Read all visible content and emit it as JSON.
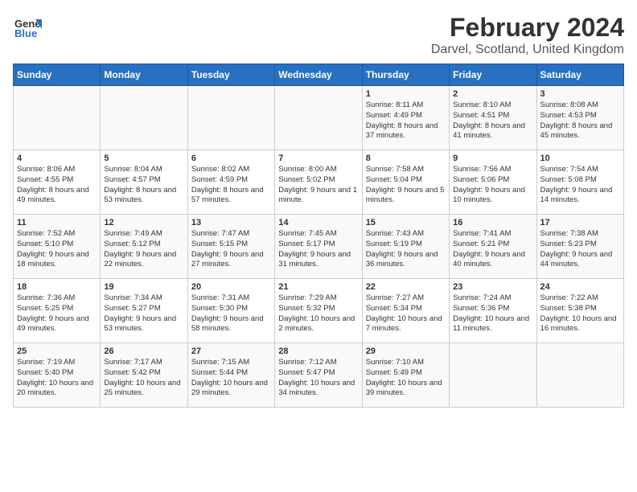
{
  "header": {
    "logo_line1": "General",
    "logo_line2": "Blue",
    "main_title": "February 2024",
    "sub_title": "Darvel, Scotland, United Kingdom"
  },
  "calendar": {
    "days_of_week": [
      "Sunday",
      "Monday",
      "Tuesday",
      "Wednesday",
      "Thursday",
      "Friday",
      "Saturday"
    ],
    "weeks": [
      [
        {
          "day": "",
          "content": ""
        },
        {
          "day": "",
          "content": ""
        },
        {
          "day": "",
          "content": ""
        },
        {
          "day": "",
          "content": ""
        },
        {
          "day": "1",
          "content": "Sunrise: 8:11 AM\nSunset: 4:49 PM\nDaylight: 8 hours\nand 37 minutes."
        },
        {
          "day": "2",
          "content": "Sunrise: 8:10 AM\nSunset: 4:51 PM\nDaylight: 8 hours\nand 41 minutes."
        },
        {
          "day": "3",
          "content": "Sunrise: 8:08 AM\nSunset: 4:53 PM\nDaylight: 8 hours\nand 45 minutes."
        }
      ],
      [
        {
          "day": "4",
          "content": "Sunrise: 8:06 AM\nSunset: 4:55 PM\nDaylight: 8 hours\nand 49 minutes."
        },
        {
          "day": "5",
          "content": "Sunrise: 8:04 AM\nSunset: 4:57 PM\nDaylight: 8 hours\nand 53 minutes."
        },
        {
          "day": "6",
          "content": "Sunrise: 8:02 AM\nSunset: 4:59 PM\nDaylight: 8 hours\nand 57 minutes."
        },
        {
          "day": "7",
          "content": "Sunrise: 8:00 AM\nSunset: 5:02 PM\nDaylight: 9 hours\nand 1 minute."
        },
        {
          "day": "8",
          "content": "Sunrise: 7:58 AM\nSunset: 5:04 PM\nDaylight: 9 hours\nand 5 minutes."
        },
        {
          "day": "9",
          "content": "Sunrise: 7:56 AM\nSunset: 5:06 PM\nDaylight: 9 hours\nand 10 minutes."
        },
        {
          "day": "10",
          "content": "Sunrise: 7:54 AM\nSunset: 5:08 PM\nDaylight: 9 hours\nand 14 minutes."
        }
      ],
      [
        {
          "day": "11",
          "content": "Sunrise: 7:52 AM\nSunset: 5:10 PM\nDaylight: 9 hours\nand 18 minutes."
        },
        {
          "day": "12",
          "content": "Sunrise: 7:49 AM\nSunset: 5:12 PM\nDaylight: 9 hours\nand 22 minutes."
        },
        {
          "day": "13",
          "content": "Sunrise: 7:47 AM\nSunset: 5:15 PM\nDaylight: 9 hours\nand 27 minutes."
        },
        {
          "day": "14",
          "content": "Sunrise: 7:45 AM\nSunset: 5:17 PM\nDaylight: 9 hours\nand 31 minutes."
        },
        {
          "day": "15",
          "content": "Sunrise: 7:43 AM\nSunset: 5:19 PM\nDaylight: 9 hours\nand 36 minutes."
        },
        {
          "day": "16",
          "content": "Sunrise: 7:41 AM\nSunset: 5:21 PM\nDaylight: 9 hours\nand 40 minutes."
        },
        {
          "day": "17",
          "content": "Sunrise: 7:38 AM\nSunset: 5:23 PM\nDaylight: 9 hours\nand 44 minutes."
        }
      ],
      [
        {
          "day": "18",
          "content": "Sunrise: 7:36 AM\nSunset: 5:25 PM\nDaylight: 9 hours\nand 49 minutes."
        },
        {
          "day": "19",
          "content": "Sunrise: 7:34 AM\nSunset: 5:27 PM\nDaylight: 9 hours\nand 53 minutes."
        },
        {
          "day": "20",
          "content": "Sunrise: 7:31 AM\nSunset: 5:30 PM\nDaylight: 9 hours\nand 58 minutes."
        },
        {
          "day": "21",
          "content": "Sunrise: 7:29 AM\nSunset: 5:32 PM\nDaylight: 10 hours\nand 2 minutes."
        },
        {
          "day": "22",
          "content": "Sunrise: 7:27 AM\nSunset: 5:34 PM\nDaylight: 10 hours\nand 7 minutes."
        },
        {
          "day": "23",
          "content": "Sunrise: 7:24 AM\nSunset: 5:36 PM\nDaylight: 10 hours\nand 11 minutes."
        },
        {
          "day": "24",
          "content": "Sunrise: 7:22 AM\nSunset: 5:38 PM\nDaylight: 10 hours\nand 16 minutes."
        }
      ],
      [
        {
          "day": "25",
          "content": "Sunrise: 7:19 AM\nSunset: 5:40 PM\nDaylight: 10 hours\nand 20 minutes."
        },
        {
          "day": "26",
          "content": "Sunrise: 7:17 AM\nSunset: 5:42 PM\nDaylight: 10 hours\nand 25 minutes."
        },
        {
          "day": "27",
          "content": "Sunrise: 7:15 AM\nSunset: 5:44 PM\nDaylight: 10 hours\nand 29 minutes."
        },
        {
          "day": "28",
          "content": "Sunrise: 7:12 AM\nSunset: 5:47 PM\nDaylight: 10 hours\nand 34 minutes."
        },
        {
          "day": "29",
          "content": "Sunrise: 7:10 AM\nSunset: 5:49 PM\nDaylight: 10 hours\nand 39 minutes."
        },
        {
          "day": "",
          "content": ""
        },
        {
          "day": "",
          "content": ""
        }
      ]
    ]
  }
}
